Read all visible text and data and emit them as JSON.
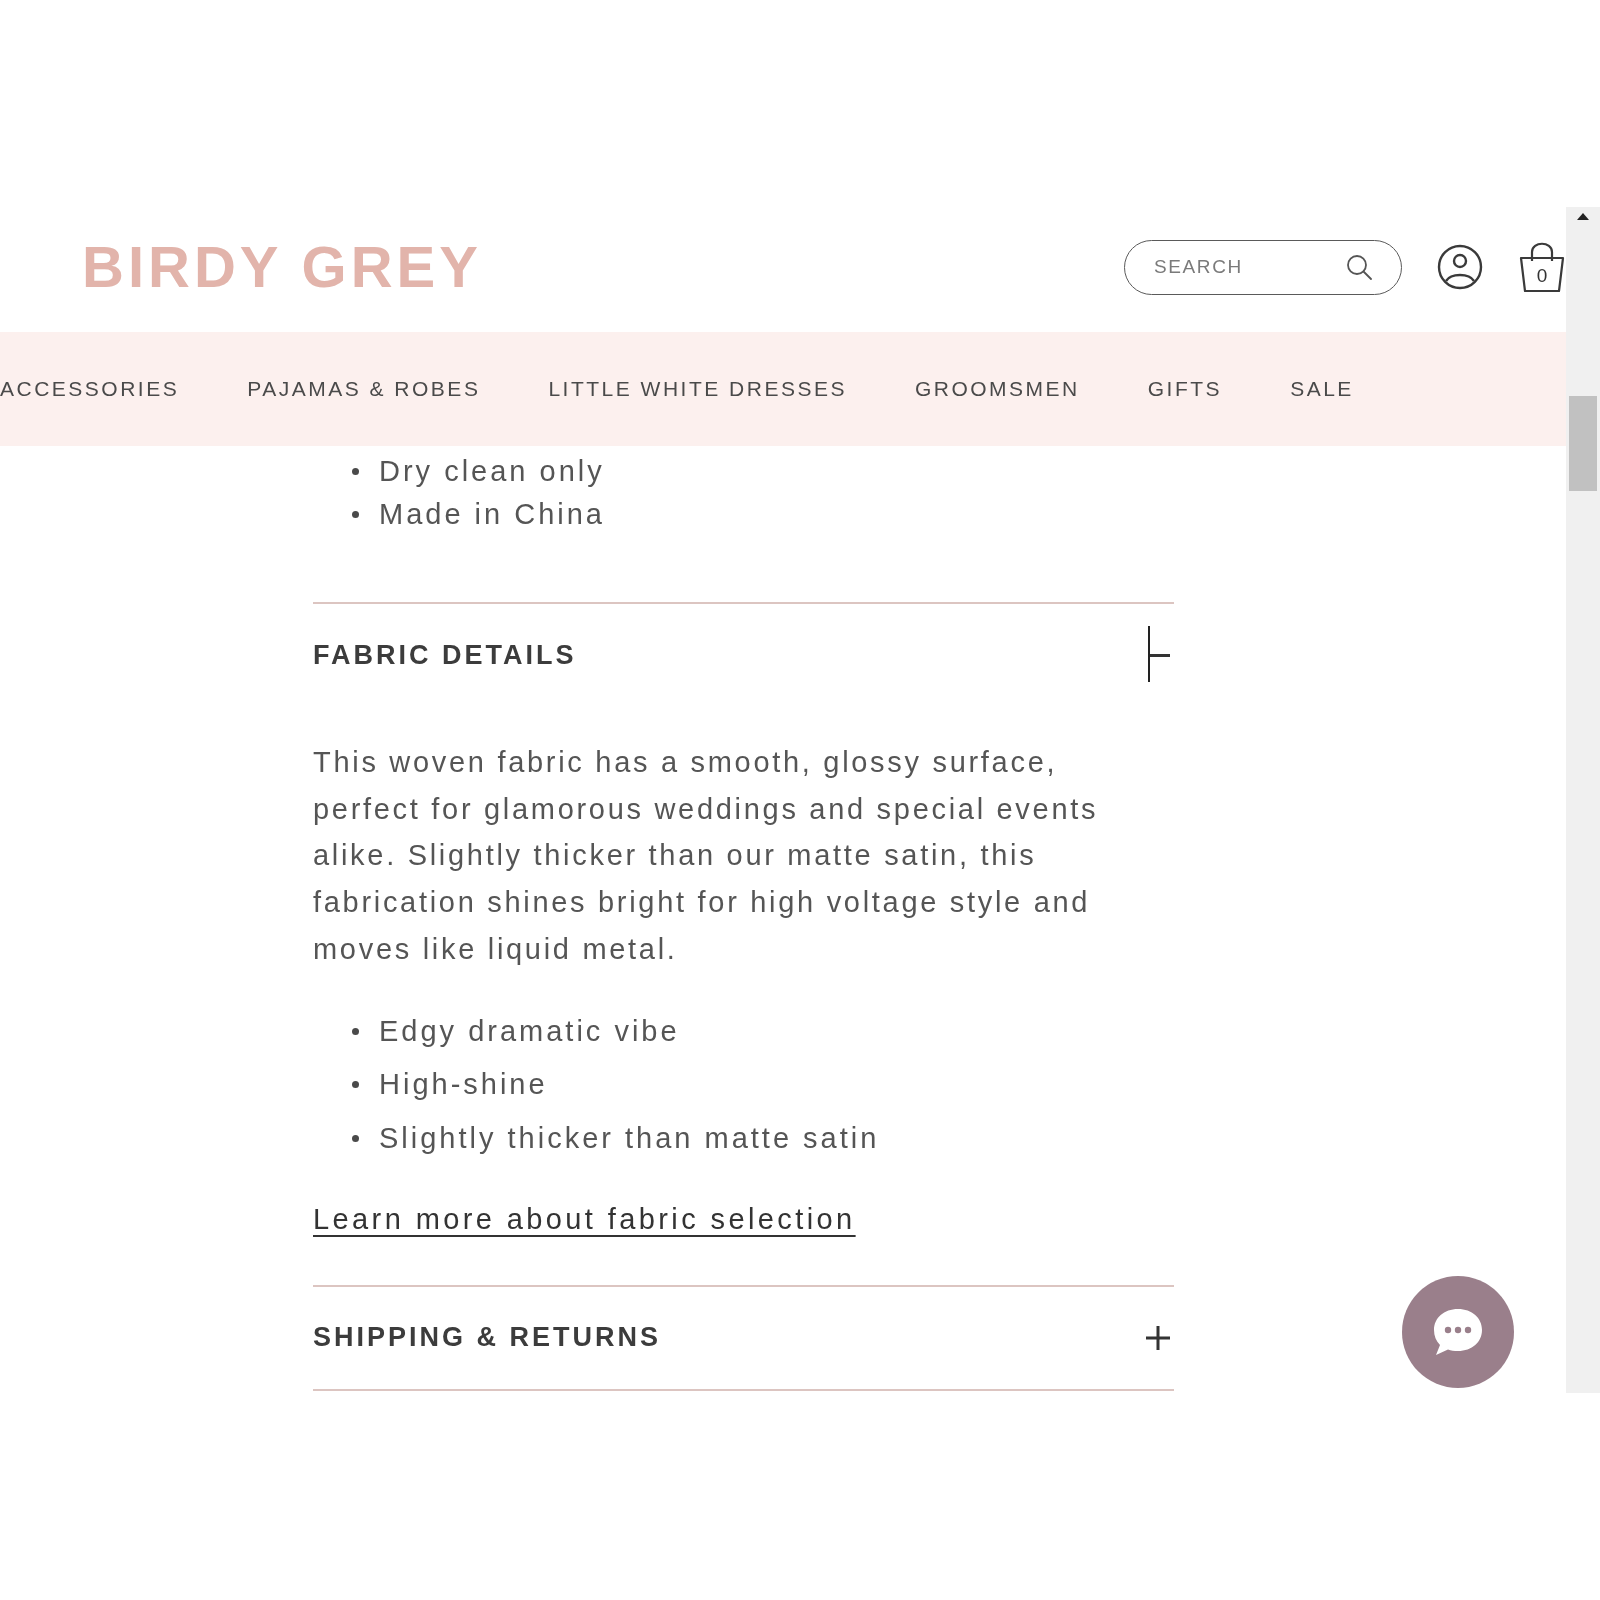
{
  "header": {
    "logo": "BIRDY GREY",
    "search": {
      "placeholder": "SEARCH"
    },
    "cart": {
      "count": "0"
    }
  },
  "nav": {
    "items": [
      "ACCESSORIES",
      "PAJAMAS & ROBES",
      "LITTLE WHITE DRESSES",
      "GROOMSMEN",
      "GIFTS",
      "SALE"
    ]
  },
  "care_list": [
    "Dry clean only",
    "Made in China"
  ],
  "sections": [
    {
      "title": "FABRIC DETAILS",
      "expanded": true,
      "description": "This woven fabric has a smooth, glossy surface, perfect for glamorous weddings and special events alike. Slightly thicker than our matte satin, this fabrication shines bright for high voltage style and moves like liquid metal.",
      "bullets": [
        "Edgy dramatic vibe",
        "High-shine",
        "Slightly thicker than matte satin"
      ],
      "link": "Learn more about fabric selection"
    },
    {
      "title": "SHIPPING & RETURNS",
      "expanded": false
    }
  ]
}
